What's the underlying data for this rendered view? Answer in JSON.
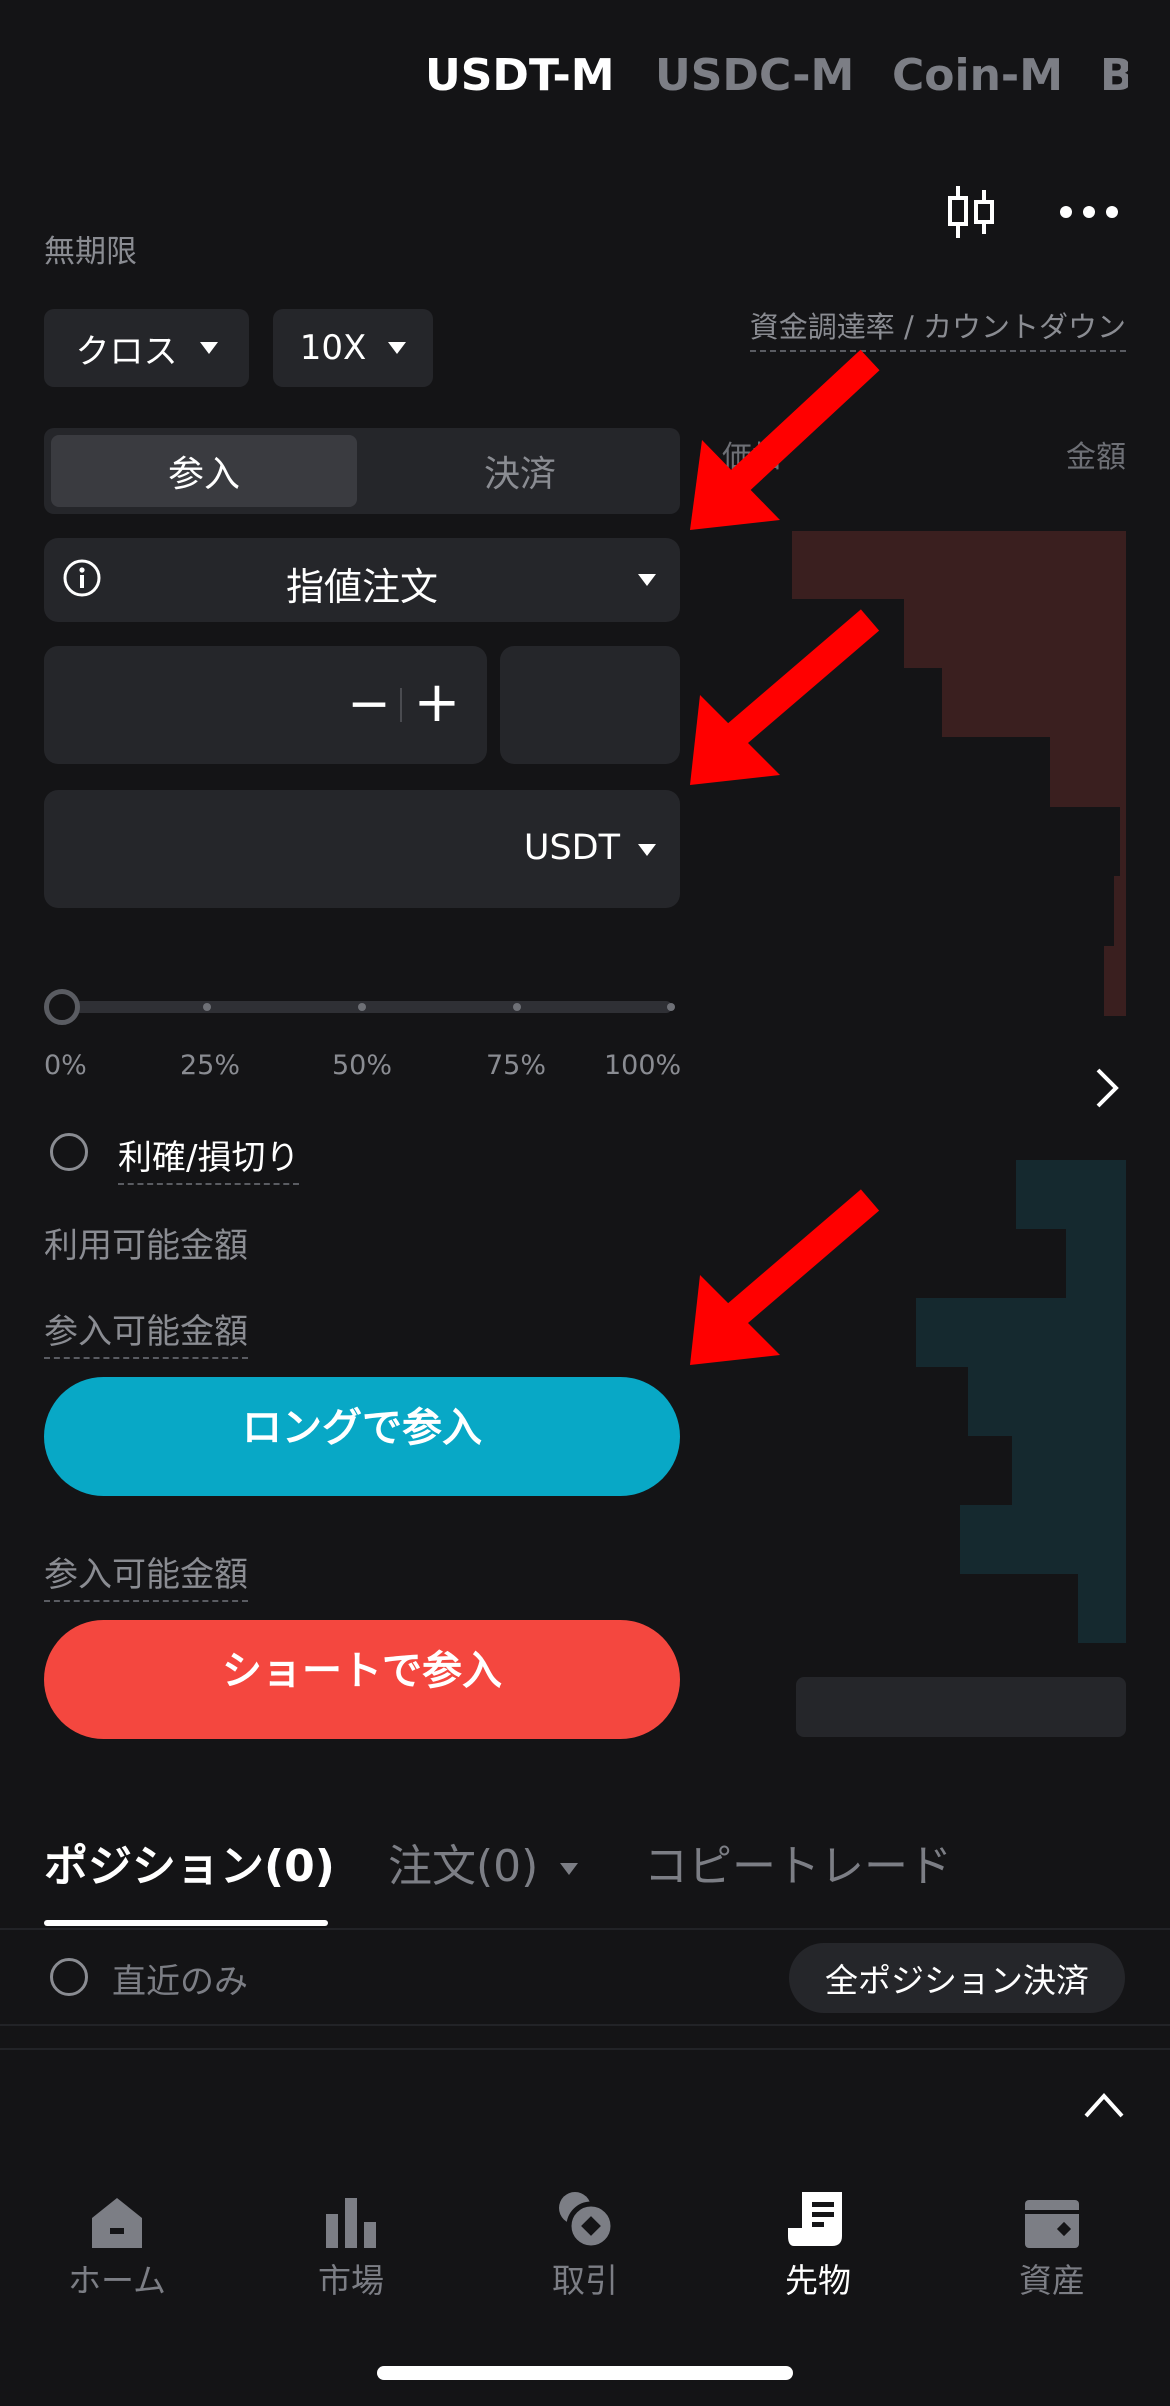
{
  "header": {
    "tabs": [
      "USDT-M",
      "USDC-M",
      "Coin-M",
      "B"
    ],
    "active_tab": "USDT-M"
  },
  "contract": {
    "type_label": "無期限",
    "funding_label": "資金調達率 / カウントダウン"
  },
  "order_form": {
    "margin_mode": "クロス",
    "leverage": "10X",
    "side_tabs": [
      "参入",
      "決済"
    ],
    "active_side": "参入",
    "order_type": "指値注文",
    "amount_unit": "USDT",
    "minus_symbol": "−",
    "plus_symbol": "+",
    "slider_labels": [
      "0%",
      "25%",
      "50%",
      "75%",
      "100%"
    ],
    "slider_value": 0,
    "tp_sl_label": "利確/損切り",
    "available_label": "利用可能金額",
    "long_max_label": "参入可能金額",
    "long_button": "ロングで参入",
    "short_max_label": "参入可能金額",
    "short_button": "ショートで参入"
  },
  "orderbook": {
    "price_header": "価格",
    "amount_header": "金額"
  },
  "positions": {
    "tabs": [
      "ポジション(0)",
      "注文(0)",
      "コピートレード"
    ],
    "active_tab": "ポジション(0)",
    "recent_only_label": "直近のみ",
    "close_all_button": "全ポジション決済"
  },
  "bottom_nav": {
    "items": [
      "ホーム",
      "市場",
      "取引",
      "先物",
      "資産"
    ],
    "active": "先物"
  },
  "colors": {
    "background": "#141416",
    "long": "#08a8c6",
    "short": "#f4473f",
    "annotation_arrow": "#ff0000"
  }
}
